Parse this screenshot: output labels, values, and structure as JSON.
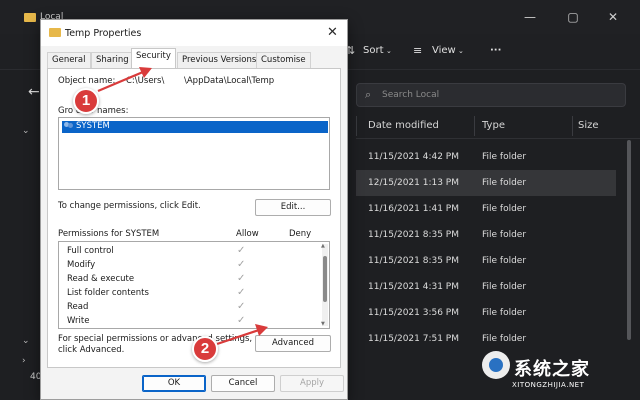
{
  "explorer": {
    "title": "Local",
    "toolbar": {
      "sort_label": "Sort",
      "view_label": "View",
      "more_label": "···"
    },
    "search_placeholder": "Search Local",
    "columns": {
      "date_modified": "Date modified",
      "type": "Type",
      "size": "Size"
    },
    "rows": [
      {
        "date": "11/15/2021 4:42 PM",
        "type": "File folder",
        "selected": false
      },
      {
        "date": "12/15/2021 1:13 PM",
        "type": "File folder",
        "selected": true
      },
      {
        "date": "11/16/2021 1:41 PM",
        "type": "File folder",
        "selected": false
      },
      {
        "date": "11/15/2021 8:35 PM",
        "type": "File folder",
        "selected": false
      },
      {
        "date": "11/15/2021 8:35 PM",
        "type": "File folder",
        "selected": false
      },
      {
        "date": "11/15/2021 4:31 PM",
        "type": "File folder",
        "selected": false
      },
      {
        "date": "11/15/2021 3:56 PM",
        "type": "File folder",
        "selected": false
      },
      {
        "date": "11/15/2021 7:51 PM",
        "type": "File folder",
        "selected": false
      }
    ],
    "status_count": "40"
  },
  "dialog": {
    "title": "Temp Properties",
    "tabs": [
      "General",
      "Sharing",
      "Security",
      "Previous Versions",
      "Customise"
    ],
    "active_tab": "Security",
    "object_name_label": "Object name:",
    "object_name_value_1": "C:\\Users\\",
    "object_name_value_2": "\\AppData\\Local\\Temp",
    "groups_label": "Gro   user names:",
    "groups": [
      "SYSTEM"
    ],
    "change_perm_text": "To change permissions, click Edit.",
    "edit_button": "Edit...",
    "perm_for_label": "Permissions for SYSTEM",
    "allow_header": "Allow",
    "deny_header": "Deny",
    "permissions": [
      {
        "name": "Full control",
        "allow": "✓"
      },
      {
        "name": "Modify",
        "allow": "✓"
      },
      {
        "name": "Read & execute",
        "allow": "✓"
      },
      {
        "name": "List folder contents",
        "allow": "✓"
      },
      {
        "name": "Read",
        "allow": "✓"
      },
      {
        "name": "Write",
        "allow": "✓"
      }
    ],
    "special_text_1": "For special permissions or advanced settings,",
    "special_text_2": "click Advanced.",
    "advanced_button": "Advanced",
    "ok_button": "OK",
    "cancel_button": "Cancel",
    "apply_button": "Apply"
  },
  "annotations": {
    "step1": "1",
    "step2": "2",
    "color": "#d93b3b"
  },
  "watermark": {
    "text": "系统之家",
    "url": "XITONGZHIJIA.NET"
  }
}
